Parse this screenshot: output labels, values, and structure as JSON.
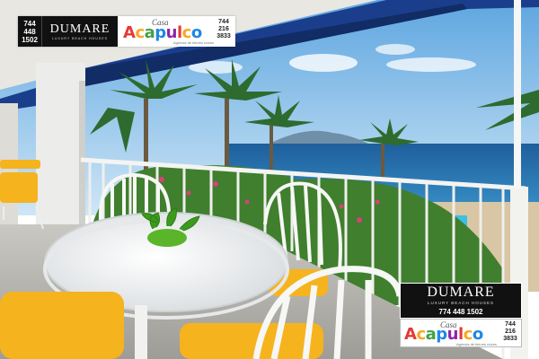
{
  "photo": {
    "subject": "balcony-terrace-ocean-view",
    "colors": {
      "sky": "#8fc3ea",
      "ocean": "#2f7fb8",
      "awning": "#1b3e8c",
      "cushion": "#f5b31e",
      "railing": "#f4f4f2"
    }
  },
  "logo_top": {
    "phone_lines": [
      "744",
      "448",
      "1502"
    ],
    "brand_name": "DUMARE",
    "brand_tagline": "LUXURY BEACH HOUSES",
    "casa_word": "Casa",
    "acapulco_letters": [
      "A",
      "c",
      "a",
      "p",
      "u",
      "l",
      "c",
      "o"
    ],
    "agency_tagline": "Agencia de bienes raíces",
    "side_lines": [
      "744",
      "216",
      "3833"
    ]
  },
  "logo_bottom": {
    "brand_name": "DUMARE",
    "brand_tagline": "LUXURY BEACH HOUSES",
    "phone": "774 448 1502",
    "casa_word": "Casa",
    "acapulco_letters": [
      "A",
      "c",
      "a",
      "p",
      "u",
      "l",
      "c",
      "o"
    ],
    "agency_tagline": "Agencia de bienes raíces",
    "side_lines": [
      "744",
      "216",
      "3833"
    ]
  }
}
